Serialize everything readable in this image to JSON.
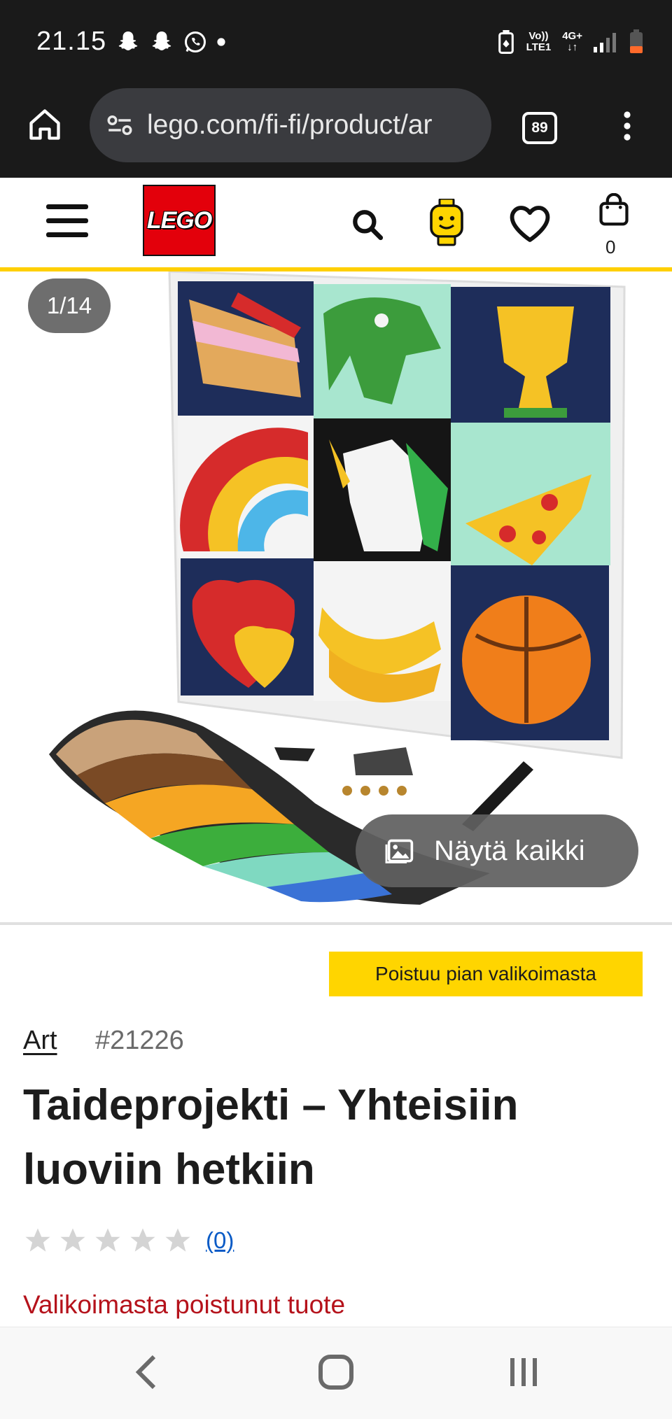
{
  "status_bar": {
    "time": "21.15",
    "net_top": "Vo))",
    "net_bottom": "LTE1",
    "net_type": "4G+"
  },
  "browser": {
    "url": "lego.com/fi-fi/product/ar",
    "tabs_count": "89"
  },
  "header": {
    "logo_text": "LEGO",
    "cart_count": "0",
    "accent_color": "#ffcf00",
    "brand_red": "#e3000b"
  },
  "gallery": {
    "counter": "1/14",
    "show_all_label": "Näytä kaikki"
  },
  "product": {
    "badge": "Poistuu pian valikoimasta",
    "theme": "Art",
    "item_number": "#21226",
    "title": "Taideprojekti – Yhteisiin luoviin hetkiin",
    "rating_stars": 0,
    "reviews": "(0)",
    "availability": "Valikoimasta poistunut tuote",
    "availability_color": "#b5121b"
  }
}
